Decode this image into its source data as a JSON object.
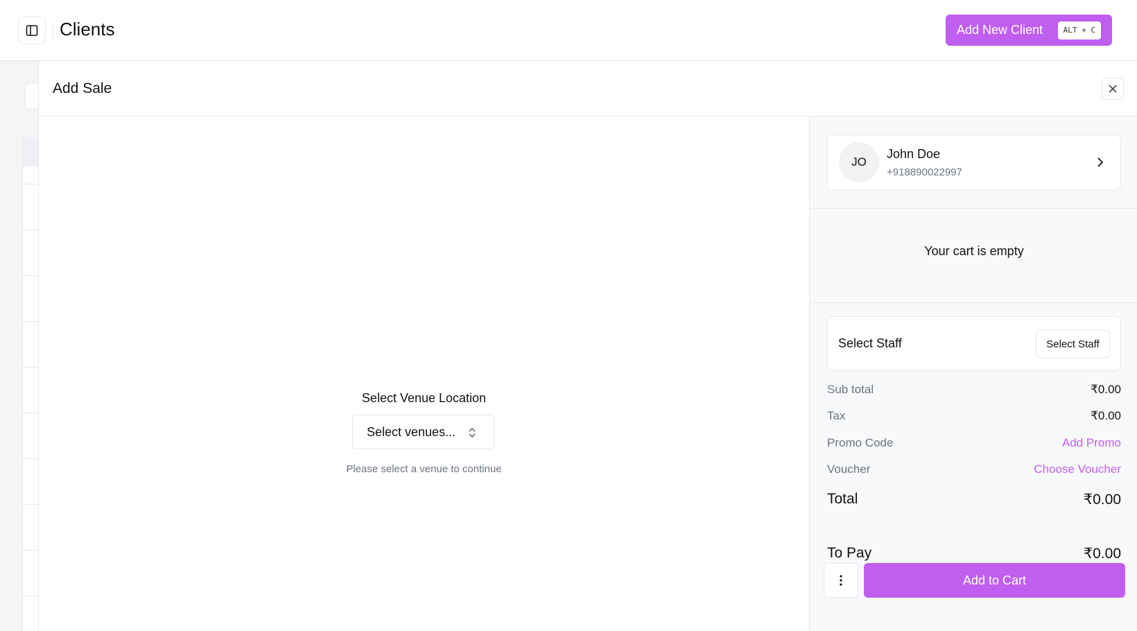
{
  "header": {
    "title": "Clients",
    "add_client_label": "Add New Client",
    "shortcut": "ALT + C",
    "toggle_icon": "sidebar-toggle-icon"
  },
  "sheet": {
    "title": "Add Sale",
    "close_icon": "close-icon",
    "venue": {
      "label": "Select Venue Location",
      "placeholder": "Select venues...",
      "hint": "Please select a venue to continue"
    },
    "client": {
      "initials": "JO",
      "name": "John Doe",
      "phone": "+918890022997"
    },
    "cart_empty": "Your cart is empty",
    "staff": {
      "label": "Select Staff",
      "button": "Select Staff"
    },
    "summary": {
      "subtotal_label": "Sub total",
      "subtotal_value": "₹0.00",
      "tax_label": "Tax",
      "tax_value": "₹0.00",
      "promo_label": "Promo Code",
      "promo_action": "Add Promo",
      "voucher_label": "Voucher",
      "voucher_action": "Choose Voucher",
      "total_label": "Total",
      "total_value": "₹0.00",
      "topay_label": "To Pay",
      "topay_value": "₹0.00"
    },
    "add_to_cart": "Add to Cart"
  },
  "colors": {
    "accent": "#c05ef0",
    "border": "#e5e7eb",
    "muted_text": "#6b7280"
  }
}
